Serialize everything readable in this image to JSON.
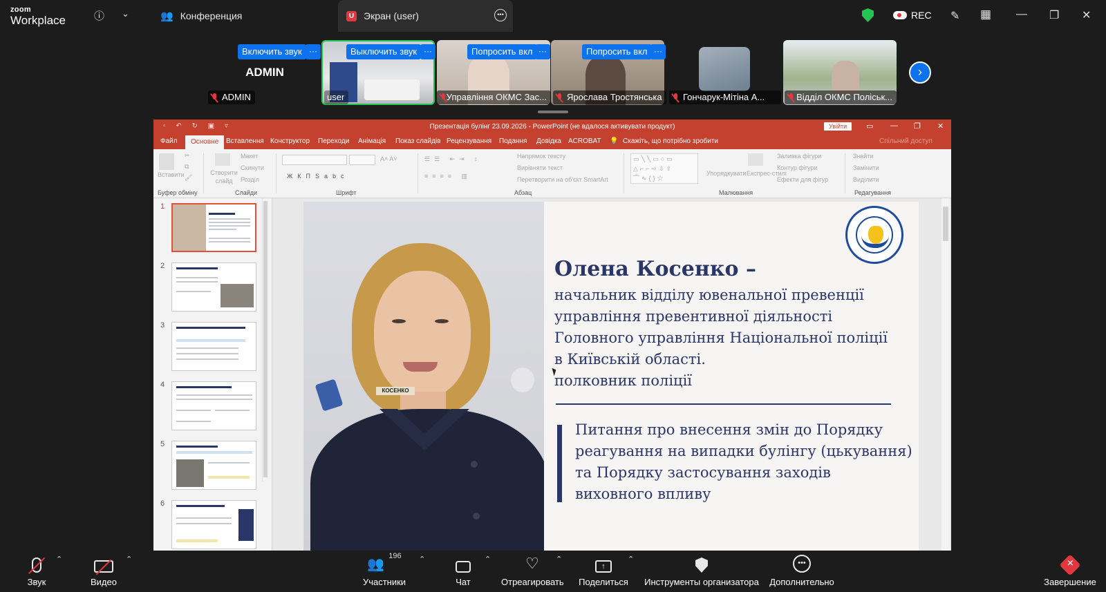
{
  "app": {
    "logo_top": "zoom",
    "logo_bottom": "Workplace"
  },
  "tabs": [
    {
      "label": "Конференция"
    },
    {
      "label": "Экран (user)",
      "badge": "U"
    }
  ],
  "titlebar": {
    "rec_label": "REC"
  },
  "participants": [
    {
      "name": "ADMIN",
      "big_name": "ADMIN",
      "action": "Включить звук"
    },
    {
      "name": "user",
      "action": "Выключить звук"
    },
    {
      "name": "Управління ОКМС Зас...",
      "action": "Попросить вкл"
    },
    {
      "name": "Ярослава Тростянська",
      "action": "Попросить вкл"
    },
    {
      "name": "Гончарук-Мітіна А..."
    },
    {
      "name": "Відділ ОКМС Поліськ..."
    }
  ],
  "more_glyph": "···",
  "next_glyph": "›",
  "powerpoint": {
    "title": "Презентація булінг 23.09.2026  -  PowerPoint (не вдалося активувати продукт)",
    "signin": "Увійти",
    "menu": [
      "Файл",
      "Основне",
      "Вставлення",
      "Конструктор",
      "Переходи",
      "Анімація",
      "Показ слайдів",
      "Рецензування",
      "Подання",
      "Довідка",
      "ACROBAT",
      "Скажіть, що потрібно зробити"
    ],
    "share": "Спільний доступ",
    "ribbon": {
      "paste": "Вставити",
      "new_slide": "Створити слайд",
      "layout": "Макет",
      "reset": "Скинути",
      "section": "Розділ",
      "text_direction": "Напрямок тексту",
      "align_text": "Вирівняти текст",
      "smartart": "Перетворити на об'єкт SmartArt",
      "arrange": "Упорядкувати",
      "quick_styles": "Експрес-стилі",
      "shape_fill": "Заливка фігури",
      "shape_outline": "Контур фігури",
      "shape_effects": "Ефекти для фігур",
      "find": "Знайти",
      "replace": "Замінити",
      "select": "Виділити",
      "groups": [
        "Буфер обміну",
        "Слайди",
        "Шрифт",
        "Абзац",
        "Малювання",
        "Редагування"
      ]
    },
    "thumbnails": [
      "1",
      "2",
      "3",
      "4",
      "5",
      "6"
    ],
    "slide": {
      "name": "Олена Косенко –",
      "position_lines": [
        "начальник відділу ювенальної превенції",
        "управління превентивної діяльності",
        "Головного управління Національної поліції",
        "в Київській області.",
        "полковник поліції"
      ],
      "topic_lines": [
        "Питання про внесення змін до Порядку",
        "реагування на випадки булінгу (цькування)",
        "та Порядку застосування заходів",
        "виховного впливу"
      ],
      "nametag": "КОСЕНКО"
    }
  },
  "toolbar": {
    "audio": "Звук",
    "video": "Видео",
    "participants": "Участники",
    "participants_count": "196",
    "chat": "Чат",
    "react": "Отреагировать",
    "share": "Поделиться",
    "host_tools": "Инструменты организатора",
    "more": "Дополнительно",
    "end": "Завершение"
  }
}
